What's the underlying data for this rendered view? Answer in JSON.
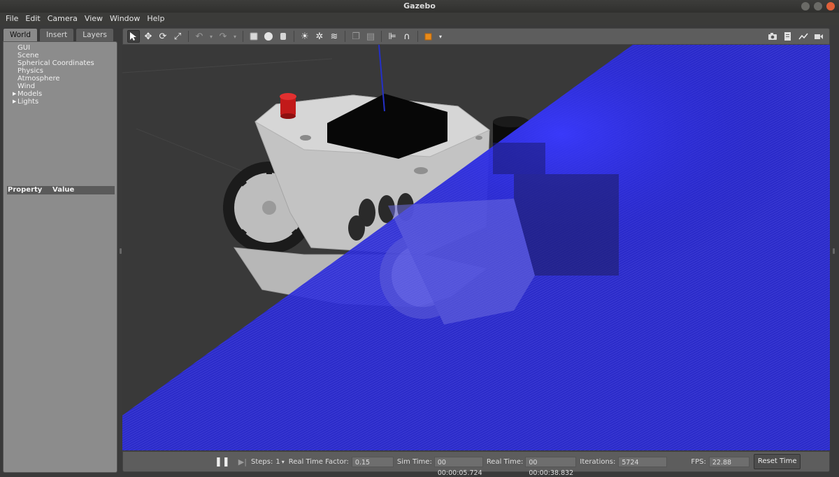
{
  "window": {
    "title": "Gazebo"
  },
  "menu": [
    "File",
    "Edit",
    "Camera",
    "View",
    "Window",
    "Help"
  ],
  "left_panel": {
    "tabs": [
      "World",
      "Insert",
      "Layers"
    ],
    "active_tab": "World",
    "tree": [
      {
        "label": "GUI",
        "expandable": false
      },
      {
        "label": "Scene",
        "expandable": false
      },
      {
        "label": "Spherical Coordinates",
        "expandable": false
      },
      {
        "label": "Physics",
        "expandable": false
      },
      {
        "label": "Atmosphere",
        "expandable": false
      },
      {
        "label": "Wind",
        "expandable": false
      },
      {
        "label": "Models",
        "expandable": true
      },
      {
        "label": "Lights",
        "expandable": true
      }
    ],
    "property_header": {
      "property": "Property",
      "value": "Value"
    }
  },
  "toolbar": {
    "tools": [
      "select-icon",
      "translate-icon",
      "rotate-icon",
      "scale-icon",
      "undo-icon",
      "redo-icon",
      "box-icon",
      "sphere-icon",
      "cylinder-icon",
      "point-light-icon",
      "spot-light-icon",
      "directional-light-icon",
      "copy-icon",
      "paste-icon",
      "align-icon",
      "snap-icon",
      "view-angle-icon"
    ],
    "right_tools": [
      "screenshot-icon",
      "log-icon",
      "plot-icon",
      "video-icon"
    ]
  },
  "bottom": {
    "steps_label": "Steps:",
    "steps_value": "1",
    "rtf_label": "Real Time Factor:",
    "rtf_value": "0.15",
    "sim_time_label": "Sim Time:",
    "sim_time_value": "00 00:00:05.724",
    "real_time_label": "Real Time:",
    "real_time_value": "00 00:00:38.832",
    "iterations_label": "Iterations:",
    "iterations_value": "5724",
    "fps_label": "FPS:",
    "fps_value": "22.88",
    "reset_label": "Reset Time"
  },
  "colors": {
    "laser_plane": "#2323e8",
    "lidar_cap": "#e02020",
    "robot_body": "#bfbfbf",
    "background": "#393939"
  }
}
